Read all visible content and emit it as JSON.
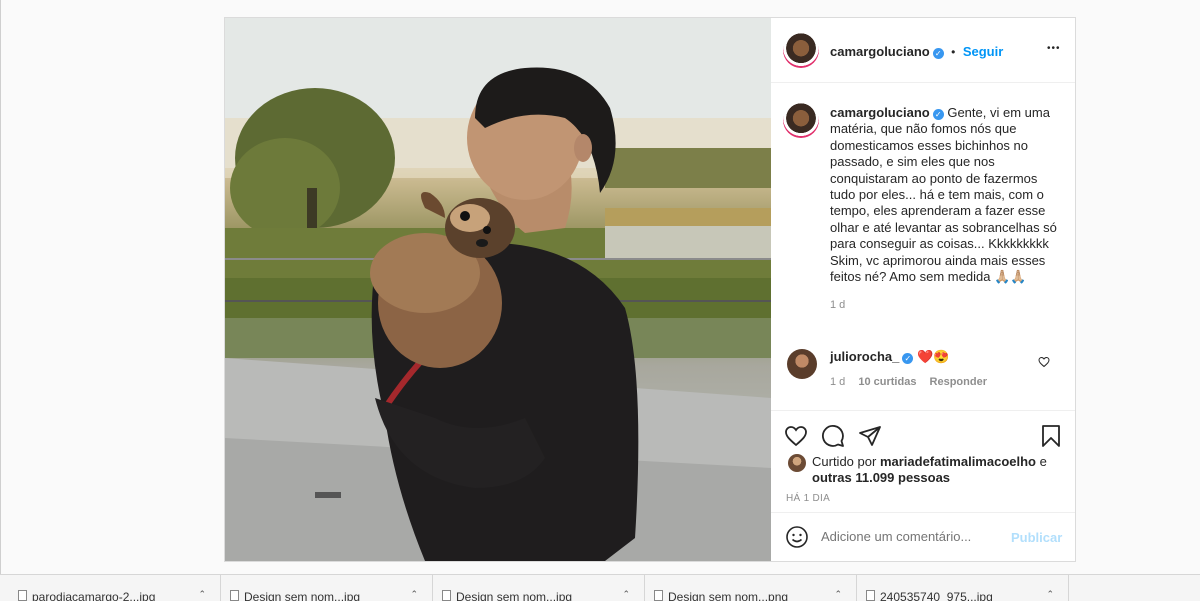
{
  "post": {
    "author": "camargoluciano",
    "follow_label": "Seguir",
    "more_label": "•••",
    "caption": "Gente, vi em uma matéria, que não fomos nós que domesticamos esses bichinhos no passado, e sim eles que nos conquistaram ao ponto de fazermos tudo por eles... há e tem mais, com o tempo, eles aprenderam a fazer esse olhar e até levantar as sobrancelhas só para conseguir as coisas... Kkkkkkkkk Skim, vc aprimorou ainda mais esses feitos né? Amo sem medida 🙏🏼🙏🏼",
    "caption_age": "1 d",
    "comment": {
      "author": "juliorocha_",
      "text": "❤️😍",
      "age": "1 d",
      "likes": "10 curtidas",
      "reply_label": "Responder"
    },
    "liked_by_prefix": "Curtido por",
    "liked_by_user": "mariadefatimalimacoelho",
    "liked_by_and": "e",
    "liked_by_others": "outras 11.099 pessoas",
    "timestamp": "HÁ 1 DIA",
    "comment_placeholder": "Adicione um comentário...",
    "publish_label": "Publicar"
  },
  "taskbar": {
    "items": [
      {
        "label": "parodiacamargo-2...jpg"
      },
      {
        "label": "Design sem nom...jpg"
      },
      {
        "label": "Design sem nom...jpg"
      },
      {
        "label": "Design sem nom...png"
      },
      {
        "label": "240535740_975...jpg"
      }
    ]
  },
  "colors": {
    "accent": "#0095f6",
    "verified": "#3897f0",
    "heart": "#ed4956"
  }
}
